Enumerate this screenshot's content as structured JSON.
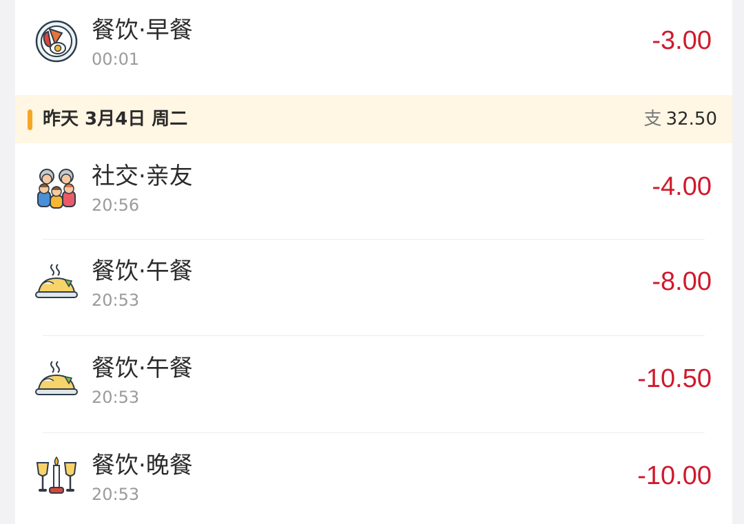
{
  "colors": {
    "amount": "#d0192c",
    "header_bg": "#fff6e3",
    "header_marker": "#f5a623"
  },
  "top_entry": {
    "icon": "breakfast-icon",
    "title": "餐饮·早餐",
    "time": "00:01",
    "amount": "-3.00"
  },
  "day_header": {
    "date": "昨天 3月4日 周二",
    "total_label": "支",
    "total_value": "32.50"
  },
  "entries": [
    {
      "icon": "family-icon",
      "title": "社交·亲友",
      "time": "20:56",
      "amount": "-4.00"
    },
    {
      "icon": "lunch-icon",
      "title": "餐饮·午餐",
      "time": "20:53",
      "amount": "-8.00"
    },
    {
      "icon": "lunch-icon",
      "title": "餐饮·午餐",
      "time": "20:53",
      "amount": "-10.50"
    },
    {
      "icon": "dinner-icon",
      "title": "餐饮·晚餐",
      "time": "20:53",
      "amount": "-10.00"
    }
  ]
}
